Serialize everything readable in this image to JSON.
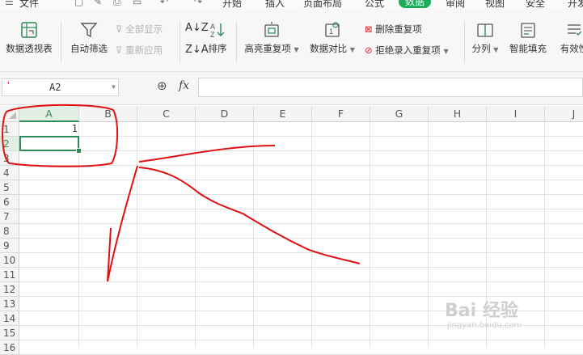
{
  "menubar": {
    "file_label": "文件",
    "tabs": [
      "开始",
      "插入",
      "页面布局",
      "公式",
      "数据",
      "审阅",
      "视图",
      "安全",
      "开发"
    ],
    "active_tab": "数据"
  },
  "ribbon": {
    "pivot_label": "数据透视表",
    "autofilter_label": "自动筛选",
    "show_all_label": "全部显示",
    "reapply_label": "重新应用",
    "sort_label": "排序",
    "highlight_dup_label": "高亮重复项",
    "compare_label": "数据对比",
    "remove_dup_label": "删除重复项",
    "reject_dup_label": "拒绝录入重复项",
    "split_label": "分列",
    "smart_fill_label": "智能填充",
    "validity_label": "有效性"
  },
  "formula_bar": {
    "name_box": "A2",
    "fx_label": "fx",
    "formula_value": ""
  },
  "grid": {
    "columns": [
      "A",
      "B",
      "C",
      "D",
      "E",
      "F",
      "G",
      "H",
      "I",
      "J"
    ],
    "rows": [
      "1",
      "2",
      "3",
      "4",
      "5",
      "6",
      "7",
      "8",
      "9",
      "10",
      "11",
      "12",
      "13",
      "14",
      "15",
      "16"
    ],
    "selected_cell": "A2",
    "cells": {
      "A1": "1"
    }
  },
  "watermark": {
    "brand": "Bai 经验",
    "url": "jingyan.baidu.com"
  },
  "colors": {
    "accent": "#2e8b57",
    "active_tab": "#1aad5a",
    "annotation": "#e01010"
  }
}
